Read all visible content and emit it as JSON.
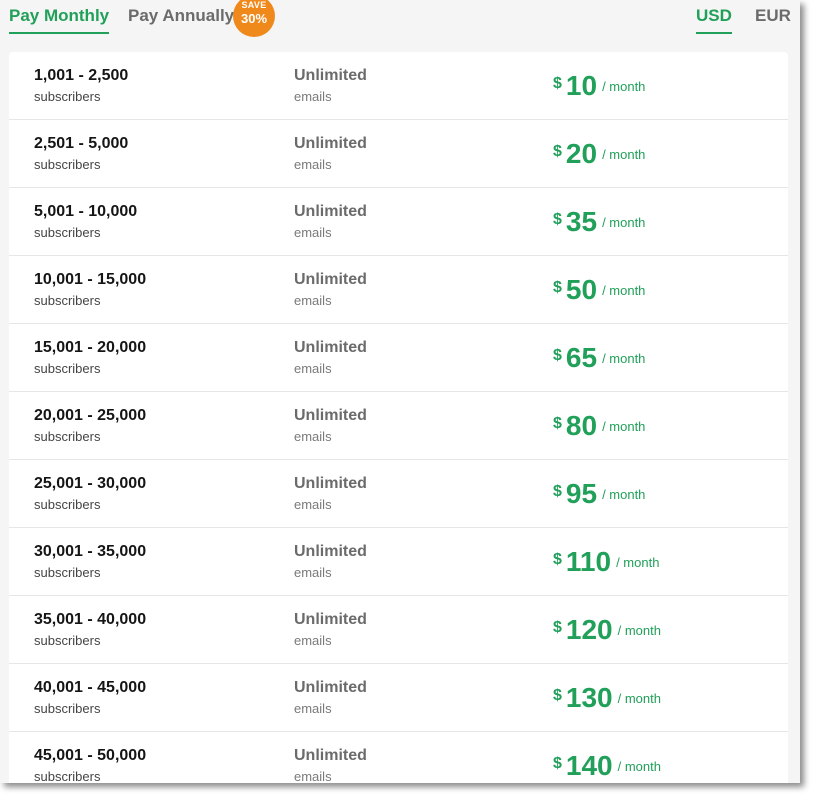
{
  "billing_tabs": [
    {
      "label": "Pay Monthly",
      "active": true
    },
    {
      "label": "Pay Annually",
      "active": false
    }
  ],
  "save_badge": {
    "line1": "SAVE",
    "line2": "30%"
  },
  "currencies": [
    {
      "label": "USD",
      "active": true
    },
    {
      "label": "EUR",
      "active": false
    }
  ],
  "colors": {
    "accent": "#21a05a",
    "badge": "#f0891c",
    "inactive": "#6b6b6b"
  },
  "pricing_rows": [
    {
      "range": "1,001 - 2,500",
      "subs_label": "subscribers",
      "emails": "Unlimited",
      "emails_label": "emails",
      "currency": "$",
      "price": "10",
      "period": "/ month"
    },
    {
      "range": "2,501 - 5,000",
      "subs_label": "subscribers",
      "emails": "Unlimited",
      "emails_label": "emails",
      "currency": "$",
      "price": "20",
      "period": "/ month"
    },
    {
      "range": "5,001 - 10,000",
      "subs_label": "subscribers",
      "emails": "Unlimited",
      "emails_label": "emails",
      "currency": "$",
      "price": "35",
      "period": "/ month"
    },
    {
      "range": "10,001 - 15,000",
      "subs_label": "subscribers",
      "emails": "Unlimited",
      "emails_label": "emails",
      "currency": "$",
      "price": "50",
      "period": "/ month"
    },
    {
      "range": "15,001 - 20,000",
      "subs_label": "subscribers",
      "emails": "Unlimited",
      "emails_label": "emails",
      "currency": "$",
      "price": "65",
      "period": "/ month"
    },
    {
      "range": "20,001 - 25,000",
      "subs_label": "subscribers",
      "emails": "Unlimited",
      "emails_label": "emails",
      "currency": "$",
      "price": "80",
      "period": "/ month"
    },
    {
      "range": "25,001 - 30,000",
      "subs_label": "subscribers",
      "emails": "Unlimited",
      "emails_label": "emails",
      "currency": "$",
      "price": "95",
      "period": "/ month"
    },
    {
      "range": "30,001 - 35,000",
      "subs_label": "subscribers",
      "emails": "Unlimited",
      "emails_label": "emails",
      "currency": "$",
      "price": "110",
      "period": "/ month"
    },
    {
      "range": "35,001 - 40,000",
      "subs_label": "subscribers",
      "emails": "Unlimited",
      "emails_label": "emails",
      "currency": "$",
      "price": "120",
      "period": "/ month"
    },
    {
      "range": "40,001 - 45,000",
      "subs_label": "subscribers",
      "emails": "Unlimited",
      "emails_label": "emails",
      "currency": "$",
      "price": "130",
      "period": "/ month"
    },
    {
      "range": "45,001 - 50,000",
      "subs_label": "subscribers",
      "emails": "Unlimited",
      "emails_label": "emails",
      "currency": "$",
      "price": "140",
      "period": "/ month"
    }
  ]
}
